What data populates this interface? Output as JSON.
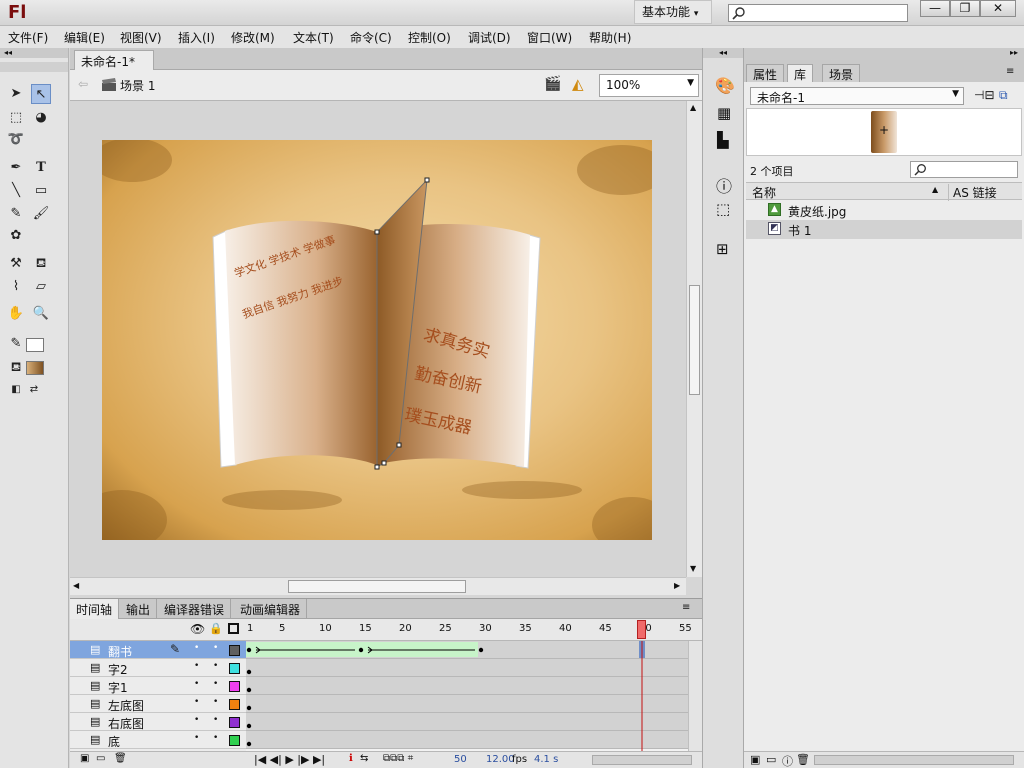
{
  "app": {
    "logo": "Fl",
    "workspace": "基本功能"
  },
  "window_controls": {
    "minimize": "—",
    "maximize": "❐",
    "close": "✕"
  },
  "menu": [
    "文件(F)",
    "编辑(E)",
    "视图(V)",
    "插入(I)",
    "修改(M)",
    "文本(T)",
    "命令(C)",
    "控制(O)",
    "调试(D)",
    "窗口(W)",
    "帮助(H)"
  ],
  "document": {
    "tab_title": "未命名-1*",
    "tab_close": "×",
    "scene": "场景 1",
    "zoom": "100%"
  },
  "stage": {
    "left_page_lines": [
      "学文化  学技术  学做事",
      "我自信  我努力  我进步"
    ],
    "right_page_lines": [
      "求真务实",
      "勤奋创新",
      "璞玉成器"
    ]
  },
  "timeline": {
    "tabs": [
      "时间轴",
      "输出",
      "编译器错误",
      "动画编辑器"
    ],
    "ruler": [
      "1",
      "5",
      "10",
      "15",
      "20",
      "25",
      "30",
      "35",
      "40",
      "45",
      "50",
      "55"
    ],
    "playhead": 50,
    "layers": [
      {
        "name": "翻书",
        "color": "#606060",
        "selected": true
      },
      {
        "name": "字2",
        "color": "#3fe0e0",
        "selected": false
      },
      {
        "name": "字1",
        "color": "#f040f0",
        "selected": false
      },
      {
        "name": "左底图",
        "color": "#f08010",
        "selected": false
      },
      {
        "name": "右底图",
        "color": "#9030d0",
        "selected": false
      },
      {
        "name": "底",
        "color": "#30d050",
        "selected": false
      }
    ],
    "tweens": [
      {
        "from": 1,
        "to": 15
      },
      {
        "from": 15,
        "to": 30
      }
    ],
    "footer": {
      "frame": "50",
      "fps_value": "12.00",
      "fps_unit": "fps",
      "time": "4.1 s"
    }
  },
  "library": {
    "tabs": [
      "属性",
      "库",
      "场景"
    ],
    "active_tab": "库",
    "document_select": "未命名-1",
    "item_count": "2 个项目",
    "col_name": "名称",
    "col_linkage": "AS 链接",
    "items": [
      {
        "name": "黄皮纸.jpg",
        "icon": "bitmap-icon"
      },
      {
        "name": "书 1",
        "icon": "graphic-symbol-icon"
      }
    ]
  }
}
